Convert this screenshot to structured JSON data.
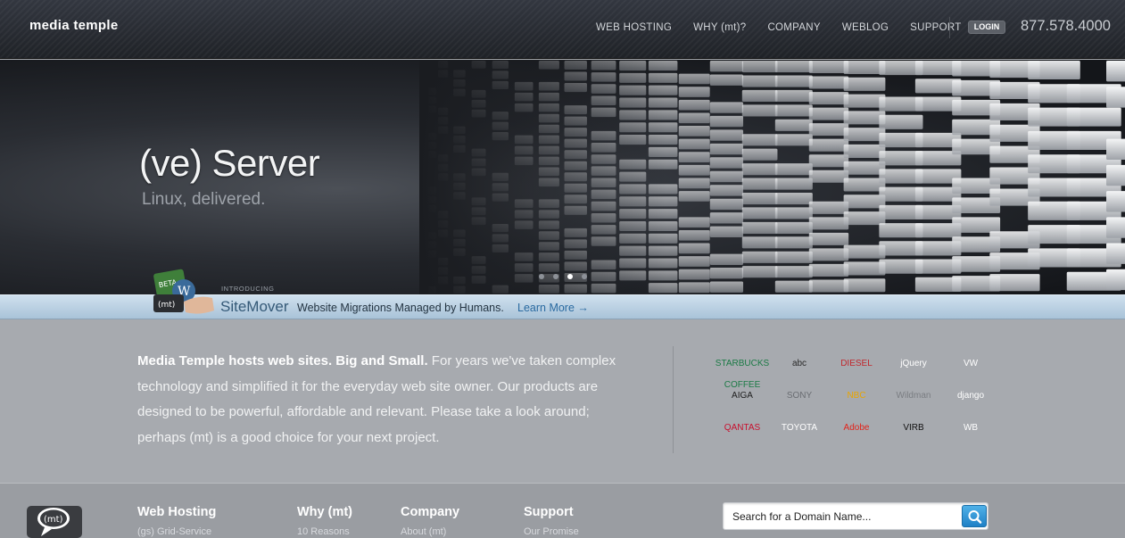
{
  "header": {
    "logo": "media temple",
    "nav": [
      "WEB HOSTING",
      "WHY (mt)?",
      "COMPANY",
      "WEBLOG",
      "SUPPORT"
    ],
    "login_label": "LOGIN",
    "phone": "877.578.4000"
  },
  "hero": {
    "title": "(ve) Server",
    "subtitle": "Linux, delivered.",
    "slide_count": 4,
    "active_slide": 3
  },
  "sitemover": {
    "introducing": "INTRODUCING",
    "name": "SiteMover",
    "tagline": "Website Migrations Managed by Humans.",
    "link": "Learn More →"
  },
  "intro": {
    "lead": "Media Temple hosts web sites. Big and Small.",
    "body": " For years we've taken complex technology and simplified it for the everyday web site owner. Our products are designed to be powerful, affordable and relevant. Please take a look around; perhaps (mt) is a good choice for your next project."
  },
  "clients": [
    {
      "label": "STARBUCKS COFFEE",
      "color": "#1b7a45"
    },
    {
      "label": "abc",
      "color": "#2a2a2a"
    },
    {
      "label": "DIESEL",
      "color": "#c0272d"
    },
    {
      "label": "jQuery",
      "color": "#ffffff"
    },
    {
      "label": "VW",
      "color": "#ffffff"
    },
    {
      "label": "AIGA",
      "color": "#1e1e1e"
    },
    {
      "label": "SONY",
      "color": "#6a6d72"
    },
    {
      "label": "NBC",
      "color": "#e8a500"
    },
    {
      "label": "Wildman",
      "color": "#7a7d82"
    },
    {
      "label": "django",
      "color": "#ffffff"
    },
    {
      "label": "QANTAS",
      "color": "#c8102e"
    },
    {
      "label": "TOYOTA",
      "color": "#ffffff"
    },
    {
      "label": "Adobe",
      "color": "#e2231a"
    },
    {
      "label": "VIRB",
      "color": "#111111"
    },
    {
      "label": "WB",
      "color": "#ffffff"
    }
  ],
  "footer": {
    "columns": [
      {
        "heading": "Web Hosting",
        "first": "(gs) Grid-Service"
      },
      {
        "heading": "Why (mt)",
        "first": "10 Reasons"
      },
      {
        "heading": "Company",
        "first": "About (mt)"
      },
      {
        "heading": "Support",
        "first": "Our Promise"
      }
    ],
    "search_placeholder": "Search for a Domain Name..."
  }
}
